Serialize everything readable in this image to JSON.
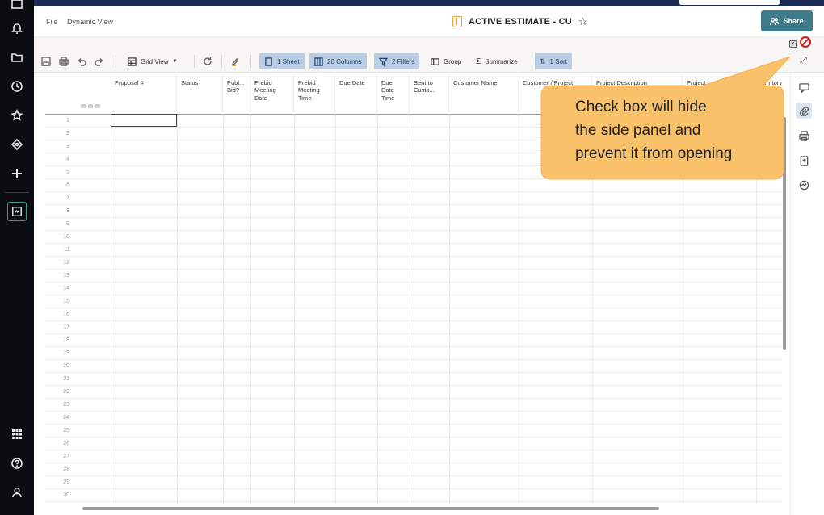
{
  "header": {
    "menu_file": "File",
    "menu_view": "Dynamic View",
    "title": "ACTIVE ESTIMATE - CU",
    "share_label": "Share"
  },
  "toolbar": {
    "grid_view": "Grid View",
    "sheet": "1 Sheet",
    "columns": "20 Columns",
    "filters": "2 Filters",
    "group": "Group",
    "summarize": "Summarize",
    "sort": "1 Sort"
  },
  "columns": [
    {
      "label": "Proposal #"
    },
    {
      "label": "Status"
    },
    {
      "label": "Publ... Bid?"
    },
    {
      "label": "Prebid Meeting Date"
    },
    {
      "label": "Prebid Meeting Time"
    },
    {
      "label": "Due Date"
    },
    {
      "label": "Due Date Time"
    },
    {
      "label": "Sent to Custo..."
    },
    {
      "label": "Customer Name"
    },
    {
      "label": "Customer / Project"
    },
    {
      "label": "Project Description"
    },
    {
      "label": "Project L..."
    },
    {
      "label": "Territory"
    }
  ],
  "row_numbers": [
    "1",
    "2",
    "3",
    "4",
    "5",
    "6",
    "7",
    "8",
    "9",
    "10",
    "11",
    "12",
    "13",
    "14",
    "15",
    "16",
    "17",
    "18",
    "19",
    "20",
    "21",
    "22",
    "23",
    "24",
    "25",
    "26",
    "27",
    "28",
    "29",
    "30"
  ],
  "callout": {
    "text_line1": "Check box will hide",
    "text_line2": "the side panel and",
    "text_line3": "prevent it from opening",
    "color": "#f8c16a"
  },
  "panel_checkbox": {
    "checked": true
  },
  "icons": {
    "rail": [
      "home-icon",
      "bell-icon",
      "folder-icon",
      "clock-icon",
      "star-icon",
      "diamond-icon",
      "plus-icon",
      "sheet-icon",
      "apps-icon",
      "help-icon",
      "user-icon"
    ],
    "right_panel": [
      "comment-icon",
      "attachment-icon",
      "print-icon",
      "summary-icon",
      "activity-icon"
    ]
  },
  "colors": {
    "rail_bg": "#0b0d12",
    "top_bar": "#1a2c55",
    "share_btn": "#3d7a8a",
    "toolbar_highlight": "#b9cde4",
    "accent_teal": "#3a9c8c"
  }
}
